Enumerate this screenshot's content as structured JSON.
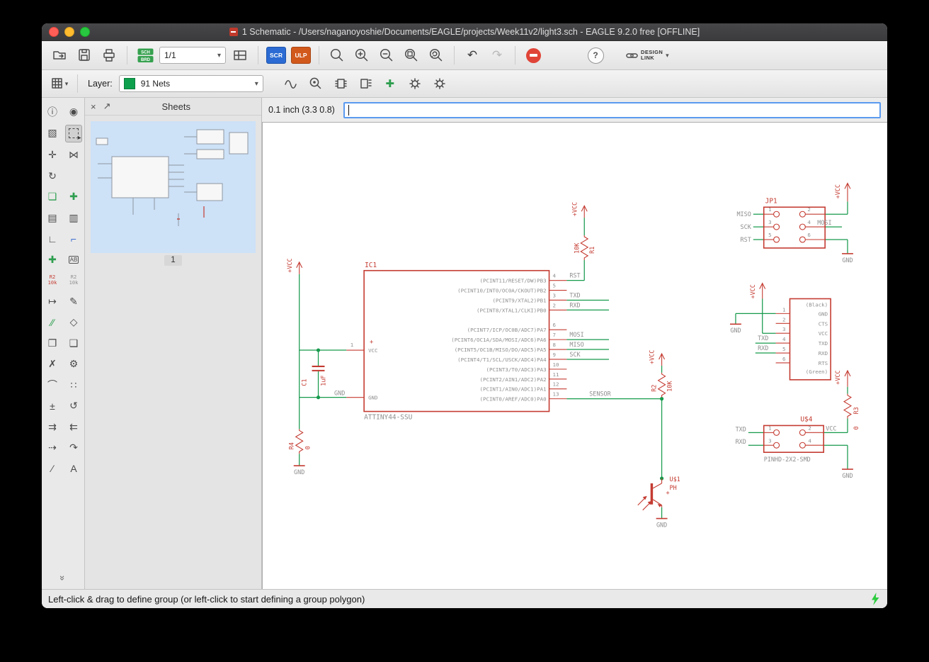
{
  "window": {
    "title": "1 Schematic - /Users/naganoyoshie/Documents/EAGLE/projects/Week11v2/light3.sch - EAGLE 9.2.0 free [OFFLINE]"
  },
  "toolbar": {
    "sch": "SCH",
    "brd": "BRD",
    "sheet_selector": "1/1",
    "scr": "SCR",
    "ulp": "ULP",
    "help": "?",
    "design_link_line1": "DESIGN",
    "design_link_line2": "LINK"
  },
  "layerbar": {
    "label": "Layer:",
    "current_layer": "91 Nets"
  },
  "commandbar": {
    "coords": "0.1 inch (3.3 0.8)",
    "command_value": ""
  },
  "sheets_panel": {
    "title": "Sheets",
    "sheet_number": "1"
  },
  "statusbar": {
    "message": "Left-click & drag to define group (or left-click to start defining a group polygon)"
  },
  "palette": {
    "value_ref": "R2",
    "value_val": "10k"
  },
  "icons": {
    "info": "ⓘ",
    "eye": "◉",
    "display": "▧",
    "group_cursor": "➤",
    "move": "✛",
    "mirror": "⋈",
    "rotate": "↻",
    "copy": "❏",
    "add": "✚",
    "replace": "▤",
    "gateswap": "▥",
    "bend1": "∟",
    "bend2": "⌐",
    "junction": "✚",
    "label_ab": "AB",
    "pin": "↦",
    "polygon": "✎",
    "net": "∕∕",
    "bus": "◇",
    "cut": "❐",
    "paste": "❑",
    "delete": "✗",
    "wrench": "⚙",
    "arc": "⌒",
    "dots": "∷",
    "dimension": "±",
    "loop": "↺",
    "split": "⇉",
    "merge": "⇇",
    "ripup": "⇢",
    "swap": "↷",
    "line": "∕",
    "text": "A",
    "collapse": "»",
    "caret": "▾",
    "close": "×",
    "detach": "↗",
    "undo": "↶",
    "redo": "↷",
    "sine": "≈"
  },
  "schematic": {
    "vcc_label": "+VCC",
    "gnd_label": "GND",
    "ic1": {
      "ref": "IC1",
      "value": "ATTINY44-SSU",
      "plus": "+",
      "pin1_number": "1",
      "vcc_name": "VCC",
      "gnd_name": "GND",
      "gnd_net": "GND",
      "rows": [
        {
          "name": "(PCINT11/RESET/DW)PB3",
          "number": "4",
          "net": "RST"
        },
        {
          "name": "(PCINT10/INT0/OC0A/CKOUT)PB2",
          "number": "5",
          "net": ""
        },
        {
          "name": "(PCINT9/XTAL2)PB1",
          "number": "3",
          "net": "TXD"
        },
        {
          "name": "(PCINT8/XTAL1/CLKI)PB0",
          "number": "2",
          "net": "RXD"
        },
        {
          "name": "(PCINT7/ICP/OC0B/ADC7)PA7",
          "number": "6",
          "net": ""
        },
        {
          "name": "(PCINT6/OC1A/SDA/MOSI/ADC6)PA6",
          "number": "7",
          "net": "MOSI"
        },
        {
          "name": "(PCINT5/OC1B/MISO/DO/ADC5)PA5",
          "number": "8",
          "net": "MISO"
        },
        {
          "name": "(PCINT4/T1/SCL/USCK/ADC4)PA4",
          "number": "9",
          "net": "SCK"
        },
        {
          "name": "(PCINT3/T0/ADC3)PA3",
          "number": "10",
          "net": ""
        },
        {
          "name": "(PCINT2/AIN1/ADC2)PA2",
          "number": "11",
          "net": ""
        },
        {
          "name": "(PCINT1/AIN0/ADC1)PA1",
          "number": "12",
          "net": ""
        },
        {
          "name": "(PCINT0/AREF/ADC0)PA0",
          "number": "13",
          "net": "SENSOR"
        }
      ]
    },
    "r1": {
      "ref": "R1",
      "value": "10K"
    },
    "r2": {
      "ref": "R2",
      "value": "10K"
    },
    "r3": {
      "ref": "R3",
      "value": "0"
    },
    "r4": {
      "ref": "R4",
      "value": "0"
    },
    "c1": {
      "ref": "C1",
      "value": "1uF"
    },
    "u1": {
      "ref": "U$1",
      "value": "PH",
      "plus": "+"
    },
    "jp1": {
      "ref": "JP1",
      "pin_numbers": [
        "1",
        "2",
        "3",
        "4",
        "5",
        "6"
      ],
      "net_miso": "MISO",
      "net_sck": "SCK",
      "net_rst": "RST",
      "net_mosi": "MOSI"
    },
    "ftdi": {
      "pin_numbers": [
        "1",
        "2",
        "3",
        "4",
        "5",
        "6"
      ],
      "pin_labels": [
        "(Black)",
        "GND",
        "CTS",
        "VCC",
        "TXD",
        "RXD",
        "RTS",
        "(Green)"
      ],
      "net_txd": "TXD",
      "net_rxd": "RXD"
    },
    "u4": {
      "ref": "U$4",
      "value": "PINHD-2X2-SMD",
      "pin_numbers": [
        "1",
        "2",
        "3",
        "4"
      ],
      "net_txd": "TXD",
      "net_rxd": "RXD",
      "net_vcc": "VCC"
    }
  }
}
